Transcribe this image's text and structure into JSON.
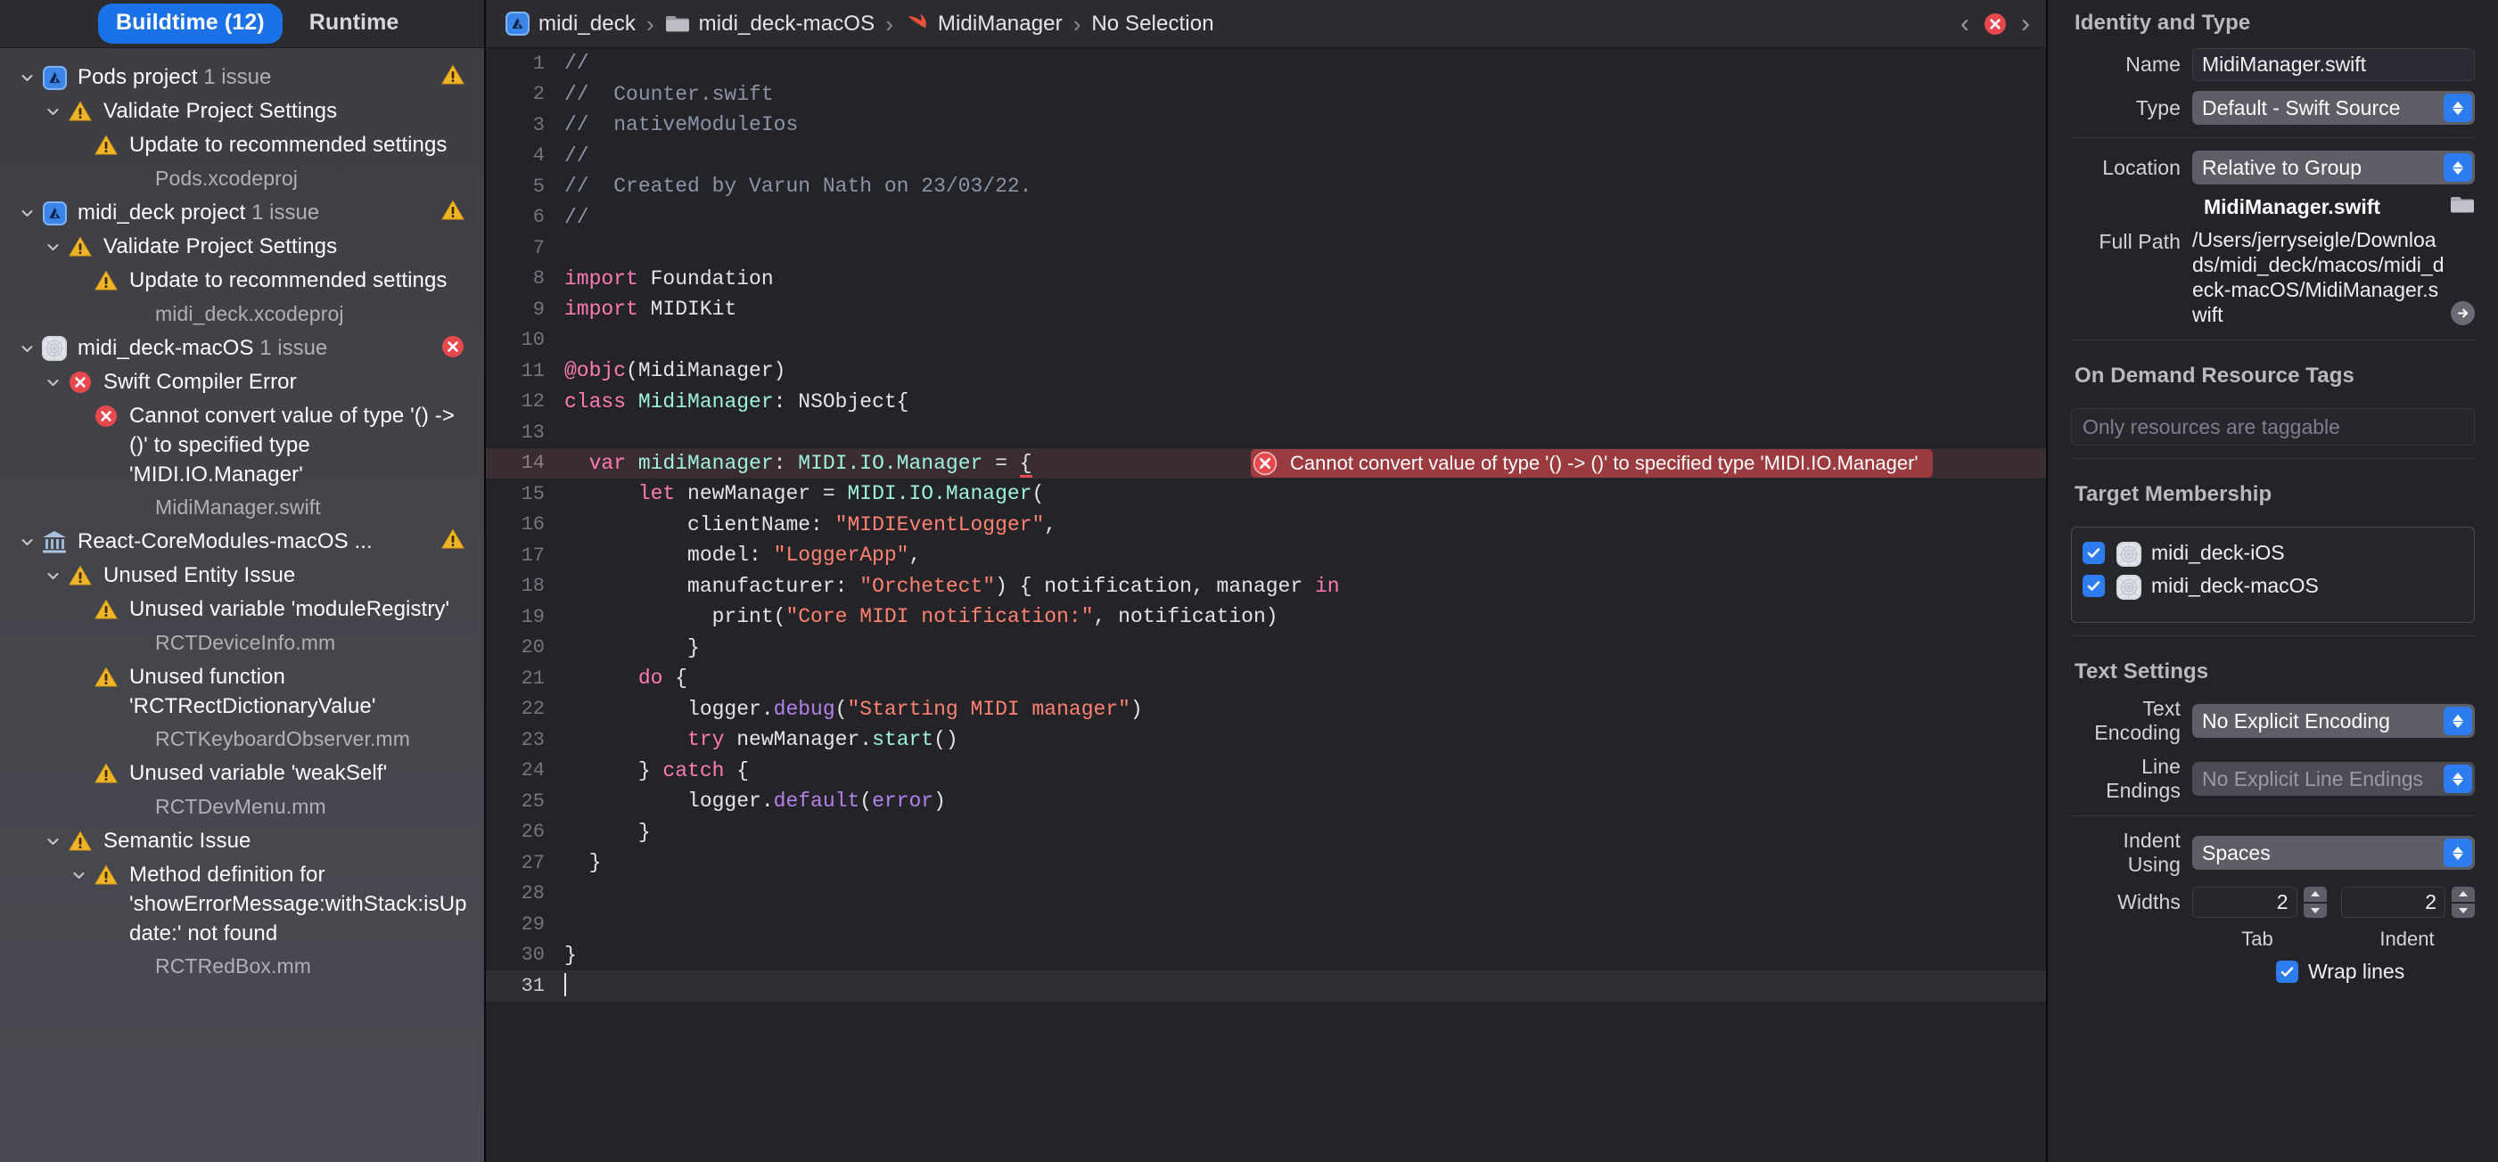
{
  "navigator": {
    "tabs": [
      {
        "label": "Buildtime (12)",
        "active": true
      },
      {
        "label": "Runtime",
        "active": false
      }
    ],
    "rows": [
      {
        "indent": 0,
        "twisty": "down",
        "icon": "xcode-project-icon",
        "label": "Pods project",
        "count": "1 issue",
        "badge": "warning",
        "kind": "project"
      },
      {
        "indent": 1,
        "twisty": "down",
        "icon": "warning-icon",
        "label": "Validate Project Settings",
        "kind": "group"
      },
      {
        "indent": 2,
        "twisty": "none",
        "icon": "warning-icon",
        "label": "Update to recommended settings",
        "kind": "issue"
      },
      {
        "indent": 3,
        "twisty": "none",
        "icon": "none",
        "label": "Pods.xcodeproj",
        "kind": "file"
      },
      {
        "indent": 0,
        "twisty": "down",
        "icon": "xcode-project-icon",
        "label": "midi_deck project",
        "count": "1 issue",
        "badge": "warning",
        "kind": "project"
      },
      {
        "indent": 1,
        "twisty": "down",
        "icon": "warning-icon",
        "label": "Validate Project Settings",
        "kind": "group"
      },
      {
        "indent": 2,
        "twisty": "none",
        "icon": "warning-icon",
        "label": "Update to recommended settings",
        "kind": "issue"
      },
      {
        "indent": 3,
        "twisty": "none",
        "icon": "none",
        "label": "midi_deck.xcodeproj",
        "kind": "file"
      },
      {
        "indent": 0,
        "twisty": "down",
        "icon": "target-icon",
        "label": "midi_deck-macOS",
        "count": "1 issue",
        "badge": "error",
        "kind": "target"
      },
      {
        "indent": 1,
        "twisty": "down",
        "icon": "error-icon",
        "label": "Swift Compiler Error",
        "kind": "group"
      },
      {
        "indent": 2,
        "twisty": "none",
        "icon": "error-icon",
        "label": "Cannot convert value of type '() -> ()' to specified type 'MIDI.IO.Manager'",
        "kind": "issue"
      },
      {
        "indent": 3,
        "twisty": "none",
        "icon": "none",
        "label": "MidiManager.swift",
        "kind": "file"
      },
      {
        "indent": 0,
        "twisty": "down",
        "icon": "library-icon",
        "label": "React-CoreModules-macOS ...",
        "badge": "warning",
        "kind": "target"
      },
      {
        "indent": 1,
        "twisty": "down",
        "icon": "warning-icon",
        "label": "Unused Entity Issue",
        "kind": "group"
      },
      {
        "indent": 2,
        "twisty": "none",
        "icon": "warning-icon",
        "label": "Unused variable 'moduleRegistry'",
        "kind": "issue"
      },
      {
        "indent": 3,
        "twisty": "none",
        "icon": "none",
        "label": "RCTDeviceInfo.mm",
        "kind": "file"
      },
      {
        "indent": 2,
        "twisty": "none",
        "icon": "warning-icon",
        "label": "Unused function 'RCTRectDictionaryValue'",
        "kind": "issue"
      },
      {
        "indent": 3,
        "twisty": "none",
        "icon": "none",
        "label": "RCTKeyboardObserver.mm",
        "kind": "file"
      },
      {
        "indent": 2,
        "twisty": "none",
        "icon": "warning-icon",
        "label": "Unused variable 'weakSelf'",
        "kind": "issue"
      },
      {
        "indent": 3,
        "twisty": "none",
        "icon": "none",
        "label": "RCTDevMenu.mm",
        "kind": "file"
      },
      {
        "indent": 1,
        "twisty": "down",
        "icon": "warning-icon",
        "label": "Semantic Issue",
        "kind": "group"
      },
      {
        "indent": 2,
        "twisty": "down",
        "icon": "warning-icon",
        "label": "Method definition for 'showErrorMessage:withStack:isUpdate:' not found",
        "kind": "issue"
      },
      {
        "indent": 3,
        "twisty": "none",
        "icon": "none",
        "label": "RCTRedBox.mm",
        "kind": "file"
      }
    ]
  },
  "jumpbar": {
    "crumbs": [
      {
        "icon": "xcode-project-icon",
        "label": "midi_deck"
      },
      {
        "icon": "folder-icon",
        "label": "midi_deck-macOS"
      },
      {
        "icon": "swift-file-icon",
        "label": "MidiManager"
      },
      {
        "icon": "none",
        "label": "No Selection"
      }
    ],
    "separator": "›",
    "prev_label": "‹",
    "next_label": "›",
    "issue_badge": "error-icon"
  },
  "editor": {
    "error_annotation": "Cannot convert value of type '() -> ()' to specified type 'MIDI.IO.Manager'",
    "lines": [
      {
        "n": "1",
        "tokens": [
          {
            "t": "//",
            "c": "cmt"
          }
        ]
      },
      {
        "n": "2",
        "tokens": [
          {
            "t": "//  Counter.swift",
            "c": "cmt"
          }
        ]
      },
      {
        "n": "3",
        "tokens": [
          {
            "t": "//  nativeModuleIos",
            "c": "cmt"
          }
        ]
      },
      {
        "n": "4",
        "tokens": [
          {
            "t": "//",
            "c": "cmt"
          }
        ]
      },
      {
        "n": "5",
        "tokens": [
          {
            "t": "//  Created by Varun Nath on 23/03/22.",
            "c": "cmt"
          }
        ]
      },
      {
        "n": "6",
        "tokens": [
          {
            "t": "//",
            "c": "cmt"
          }
        ]
      },
      {
        "n": "7",
        "tokens": []
      },
      {
        "n": "8",
        "tokens": [
          {
            "t": "import",
            "c": "kw"
          },
          {
            "t": " Foundation",
            "c": "plain"
          }
        ]
      },
      {
        "n": "9",
        "tokens": [
          {
            "t": "import",
            "c": "kw"
          },
          {
            "t": " MIDIKit",
            "c": "plain"
          }
        ]
      },
      {
        "n": "10",
        "tokens": []
      },
      {
        "n": "11",
        "tokens": [
          {
            "t": "@objc",
            "c": "attr"
          },
          {
            "t": "(MidiManager)",
            "c": "plain"
          }
        ]
      },
      {
        "n": "12",
        "tokens": [
          {
            "t": "class",
            "c": "kw"
          },
          {
            "t": " ",
            "c": "plain"
          },
          {
            "t": "MidiManager",
            "c": "typ"
          },
          {
            "t": ": NSObject{",
            "c": "plain"
          }
        ]
      },
      {
        "n": "13",
        "tokens": []
      },
      {
        "n": "14",
        "hl": true,
        "error": true,
        "tokens": [
          {
            "t": "  ",
            "c": "plain"
          },
          {
            "t": "var",
            "c": "kw"
          },
          {
            "t": " ",
            "c": "plain"
          },
          {
            "t": "midiManager",
            "c": "var"
          },
          {
            "t": ": ",
            "c": "plain"
          },
          {
            "t": "MIDI.IO.Manager",
            "c": "typ"
          },
          {
            "t": " = ",
            "c": "plain"
          },
          {
            "t": "{",
            "c": "squig"
          }
        ]
      },
      {
        "n": "15",
        "tokens": [
          {
            "t": "      ",
            "c": "plain"
          },
          {
            "t": "let",
            "c": "kw"
          },
          {
            "t": " newManager = ",
            "c": "plain"
          },
          {
            "t": "MIDI.IO.Manager",
            "c": "typ"
          },
          {
            "t": "(",
            "c": "plain"
          }
        ]
      },
      {
        "n": "16",
        "tokens": [
          {
            "t": "          clientName: ",
            "c": "plain"
          },
          {
            "t": "\"MIDIEventLogger\"",
            "c": "str"
          },
          {
            "t": ",",
            "c": "plain"
          }
        ]
      },
      {
        "n": "17",
        "tokens": [
          {
            "t": "          model: ",
            "c": "plain"
          },
          {
            "t": "\"LoggerApp\"",
            "c": "str"
          },
          {
            "t": ",",
            "c": "plain"
          }
        ]
      },
      {
        "n": "18",
        "tokens": [
          {
            "t": "          manufacturer: ",
            "c": "plain"
          },
          {
            "t": "\"Orchetect\"",
            "c": "str"
          },
          {
            "t": ") { notification, manager ",
            "c": "plain"
          },
          {
            "t": "in",
            "c": "kw"
          }
        ]
      },
      {
        "n": "19",
        "tokens": [
          {
            "t": "            print(",
            "c": "plain"
          },
          {
            "t": "\"Core MIDI notification:\"",
            "c": "str"
          },
          {
            "t": ", notification)",
            "c": "plain"
          }
        ]
      },
      {
        "n": "20",
        "tokens": [
          {
            "t": "          }",
            "c": "plain"
          }
        ]
      },
      {
        "n": "21",
        "tokens": [
          {
            "t": "      ",
            "c": "plain"
          },
          {
            "t": "do",
            "c": "kw"
          },
          {
            "t": " {",
            "c": "plain"
          }
        ]
      },
      {
        "n": "22",
        "tokens": [
          {
            "t": "          logger.",
            "c": "plain"
          },
          {
            "t": "debug",
            "c": "mem"
          },
          {
            "t": "(",
            "c": "plain"
          },
          {
            "t": "\"Starting MIDI manager\"",
            "c": "str"
          },
          {
            "t": ")",
            "c": "plain"
          }
        ]
      },
      {
        "n": "23",
        "tokens": [
          {
            "t": "          ",
            "c": "plain"
          },
          {
            "t": "try",
            "c": "kw"
          },
          {
            "t": " newManager.",
            "c": "plain"
          },
          {
            "t": "start",
            "c": "typ"
          },
          {
            "t": "()",
            "c": "plain"
          }
        ]
      },
      {
        "n": "24",
        "tokens": [
          {
            "t": "      } ",
            "c": "plain"
          },
          {
            "t": "catch",
            "c": "kw"
          },
          {
            "t": " {",
            "c": "plain"
          }
        ]
      },
      {
        "n": "25",
        "tokens": [
          {
            "t": "          logger.",
            "c": "plain"
          },
          {
            "t": "default",
            "c": "mem"
          },
          {
            "t": "(",
            "c": "plain"
          },
          {
            "t": "error",
            "c": "mem"
          },
          {
            "t": ")",
            "c": "plain"
          }
        ]
      },
      {
        "n": "26",
        "tokens": [
          {
            "t": "      }",
            "c": "plain"
          }
        ]
      },
      {
        "n": "27",
        "tokens": [
          {
            "t": "  }",
            "c": "plain"
          }
        ]
      },
      {
        "n": "28",
        "tokens": []
      },
      {
        "n": "29",
        "tokens": []
      },
      {
        "n": "30",
        "tokens": [
          {
            "t": "}",
            "c": "plain"
          }
        ]
      },
      {
        "n": "31",
        "cur": true,
        "caret": true,
        "tokens": []
      }
    ]
  },
  "inspector": {
    "identity": {
      "header": "Identity and Type",
      "name_label": "Name",
      "name_value": "MidiManager.swift",
      "type_label": "Type",
      "type_value": "Default - Swift Source",
      "location_label": "Location",
      "location_value": "Relative to Group",
      "relative_name": "MidiManager.swift",
      "folder_icon": "folder-icon",
      "fullpath_label": "Full Path",
      "fullpath_value": "/Users/jerryseigle/Downloads/midi_deck/macos/midi_deck-macOS/MidiManager.swift",
      "reveal_icon": "arrow-right-icon"
    },
    "ondemand": {
      "header": "On Demand Resource Tags",
      "placeholder": "Only resources are taggable"
    },
    "target_membership": {
      "header": "Target Membership",
      "items": [
        {
          "label": "midi_deck-iOS",
          "checked": true,
          "icon": "target-icon"
        },
        {
          "label": "midi_deck-macOS",
          "checked": true,
          "icon": "target-icon"
        }
      ]
    },
    "text_settings": {
      "header": "Text Settings",
      "encoding_label": "Text Encoding",
      "encoding_value": "No Explicit Encoding",
      "endings_label": "Line Endings",
      "endings_value": "No Explicit Line Endings",
      "indent_label": "Indent Using",
      "indent_value": "Spaces",
      "widths_label": "Widths",
      "tab_width": "2",
      "indent_width": "2",
      "tab_sublabel": "Tab",
      "indent_sublabel": "Indent",
      "wrap_label": "Wrap lines",
      "wrap_checked": true
    }
  },
  "colors": {
    "accent": "#2d7cf0",
    "warning": "#f0b429",
    "error": "#e5484d",
    "sidebar_bg": "#45454c",
    "editor_bg": "#242428"
  }
}
